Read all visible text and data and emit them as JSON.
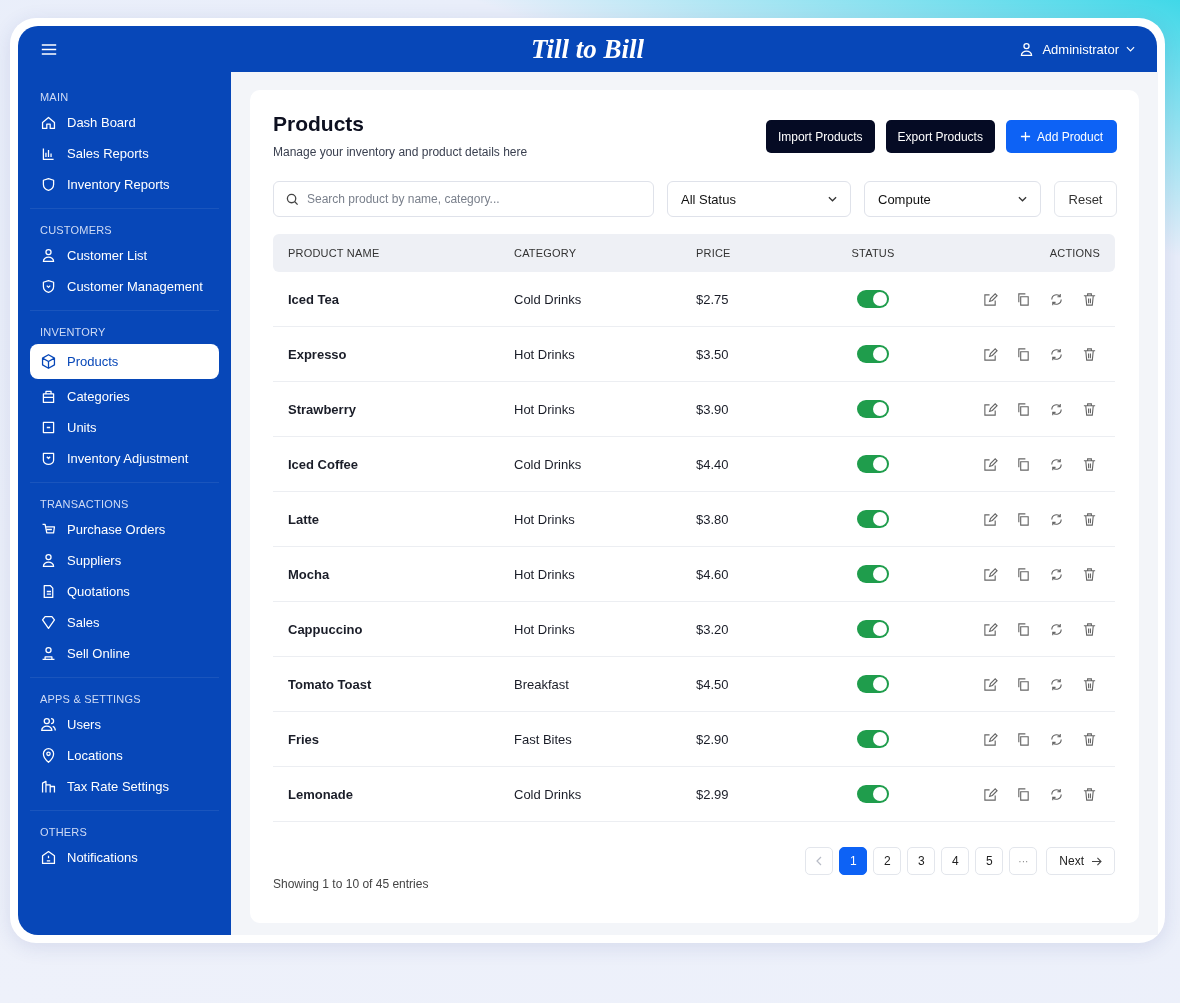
{
  "header": {
    "logo": "Till to Bill",
    "user": "Administrator"
  },
  "sidebar": {
    "sections": [
      {
        "title": "MAIN",
        "items": [
          {
            "label": "Dash Board",
            "selected": false
          },
          {
            "label": "Sales Reports",
            "selected": false
          },
          {
            "label": "Inventory Reports",
            "selected": false
          }
        ]
      },
      {
        "title": "CUSTOMERS",
        "items": [
          {
            "label": "Customer List",
            "selected": false
          },
          {
            "label": "Customer Management",
            "selected": false
          }
        ]
      },
      {
        "title": "INVENTORY",
        "items": [
          {
            "label": "Products",
            "selected": true
          },
          {
            "label": "Categories",
            "selected": false
          },
          {
            "label": "Units",
            "selected": false
          },
          {
            "label": "Inventory Adjustment",
            "selected": false
          }
        ]
      },
      {
        "title": "TRANSACTIONS",
        "items": [
          {
            "label": "Purchase Orders",
            "selected": false
          },
          {
            "label": "Suppliers",
            "selected": false
          },
          {
            "label": "Quotations",
            "selected": false
          },
          {
            "label": "Sales",
            "selected": false
          },
          {
            "label": "Sell Online",
            "selected": false
          }
        ]
      },
      {
        "title": "APPS & SETTINGS",
        "items": [
          {
            "label": "Users",
            "selected": false
          },
          {
            "label": "Locations",
            "selected": false
          },
          {
            "label": "Tax Rate Settings",
            "selected": false
          }
        ]
      },
      {
        "title": "OTHERS",
        "items": [
          {
            "label": "Notifications",
            "selected": false
          }
        ]
      }
    ]
  },
  "page": {
    "title": "Products",
    "subtitle": "Manage your inventory and product details here",
    "buttons": [
      {
        "label": "Import Products",
        "kind": "dark"
      },
      {
        "label": "Export Products",
        "kind": "dark"
      },
      {
        "label": "Add Product",
        "kind": "primary"
      }
    ]
  },
  "filters": {
    "search": {
      "placeholder": "Search product by name, category..."
    },
    "status": "All Status",
    "category": "Compute",
    "reset": "Reset"
  },
  "table": {
    "columns": [
      "PRODUCT NAME",
      "CATEGORY",
      "PRICE",
      "STATUS",
      "ACTIONS"
    ],
    "rows": [
      {
        "name": "Iced Tea",
        "category": "Cold Drinks",
        "price": "$2.75",
        "on": true
      },
      {
        "name": "Expresso",
        "category": "Hot Drinks",
        "price": "$3.50",
        "on": true
      },
      {
        "name": "Strawberry",
        "category": "Hot Drinks",
        "price": "$3.90",
        "on": true
      },
      {
        "name": "Iced Coffee",
        "category": "Cold Drinks",
        "price": "$4.40",
        "on": true
      },
      {
        "name": "Latte",
        "category": "Hot Drinks",
        "price": "$3.80",
        "on": true
      },
      {
        "name": "Mocha",
        "category": "Hot Drinks",
        "price": "$4.60",
        "on": true
      },
      {
        "name": "Cappuccino",
        "category": "Hot Drinks",
        "price": "$3.20",
        "on": true
      },
      {
        "name": "Tomato Toast",
        "category": "Breakfast",
        "price": "$4.50",
        "on": true
      },
      {
        "name": "Fries",
        "category": "Fast Bites",
        "price": "$2.90",
        "on": true
      },
      {
        "name": "Lemonade",
        "category": "Cold Drinks",
        "price": "$2.99",
        "on": true
      }
    ]
  },
  "pagination": {
    "prev_disabled": true,
    "pages": [
      {
        "label": "1",
        "selected": true
      },
      {
        "label": "2",
        "selected": false
      },
      {
        "label": "3",
        "selected": false
      },
      {
        "label": "4",
        "selected": false
      },
      {
        "label": "5",
        "selected": false
      }
    ],
    "ellipsis": "···",
    "next": "Next"
  },
  "footer": "Showing 1 to 10 of 45 entries"
}
